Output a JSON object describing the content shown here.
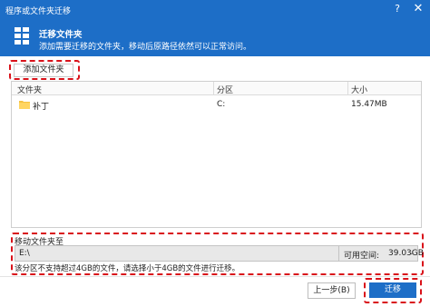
{
  "window": {
    "title": "程序或文件夹迁移",
    "help_glyph": "?",
    "close_glyph": "✕"
  },
  "header": {
    "title": "迁移文件夹",
    "subtitle": "添加需要迁移的文件夹，移动后原路径依然可以正常访问。",
    "icon": "grid-app-icon"
  },
  "toolbar": {
    "add_folder_label": "添加文件夹"
  },
  "table": {
    "columns": [
      "文件夹",
      "分区",
      "大小"
    ],
    "rows": [
      {
        "folder": "补丁",
        "partition": "C:",
        "size": "15.47MB",
        "icon": "folder-icon"
      }
    ]
  },
  "destination": {
    "label": "移动文件夹至",
    "path": "E:\\",
    "available_label": "可用空间:",
    "available_value": "39.03GB",
    "warning": "该分区不支持超过4GB的文件，请选择小于4GB的文件进行迁移。"
  },
  "footer": {
    "prev_label": "上一步(B)",
    "migrate_label": "迁移"
  },
  "colors": {
    "accent": "#1d6ec7",
    "highlight": "#d9121a"
  }
}
